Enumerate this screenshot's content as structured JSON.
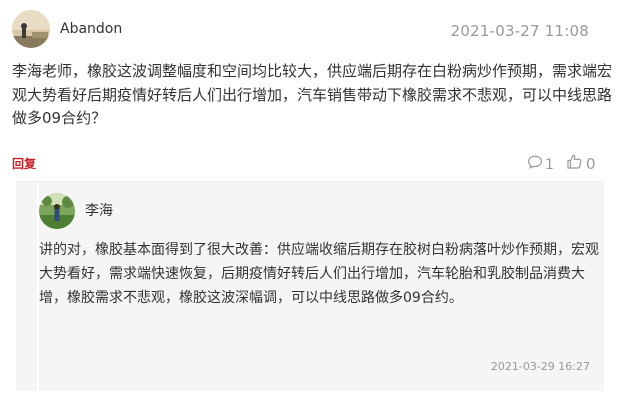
{
  "post": {
    "author": "Abandon",
    "time": "2021-03-27 11:08",
    "content": "李海老师，橡胶这波调整幅度和空间均比较大，供应端后期存在白粉病炒作预期，需求端宏观大势看好后期疫情好转后人们出行增加，汽车销售带动下橡胶需求不悲观，可以中线思路做多09合约？",
    "reply_label": "回复",
    "comment_count": "1",
    "like_count": "0"
  },
  "reply": {
    "author": "李海",
    "content": "讲的对，橡胶基本面得到了很大改善：供应端收缩后期存在胶树白粉病落叶炒作预期，宏观大势看好，需求端快速恢复，后期疫情好转后人们出行增加，汽车轮胎和乳胶制品消费大增，橡胶需求不悲观，橡胶这波深幅调，可以中线思路做多09合约。",
    "time": "2021-03-29 16:27"
  },
  "icons": {
    "comment": "comment-bubble-icon",
    "like": "thumbs-up-icon"
  },
  "colors": {
    "reply_link": "#c81e28",
    "muted_text": "#999999",
    "reply_background": "#f5f5f5"
  }
}
